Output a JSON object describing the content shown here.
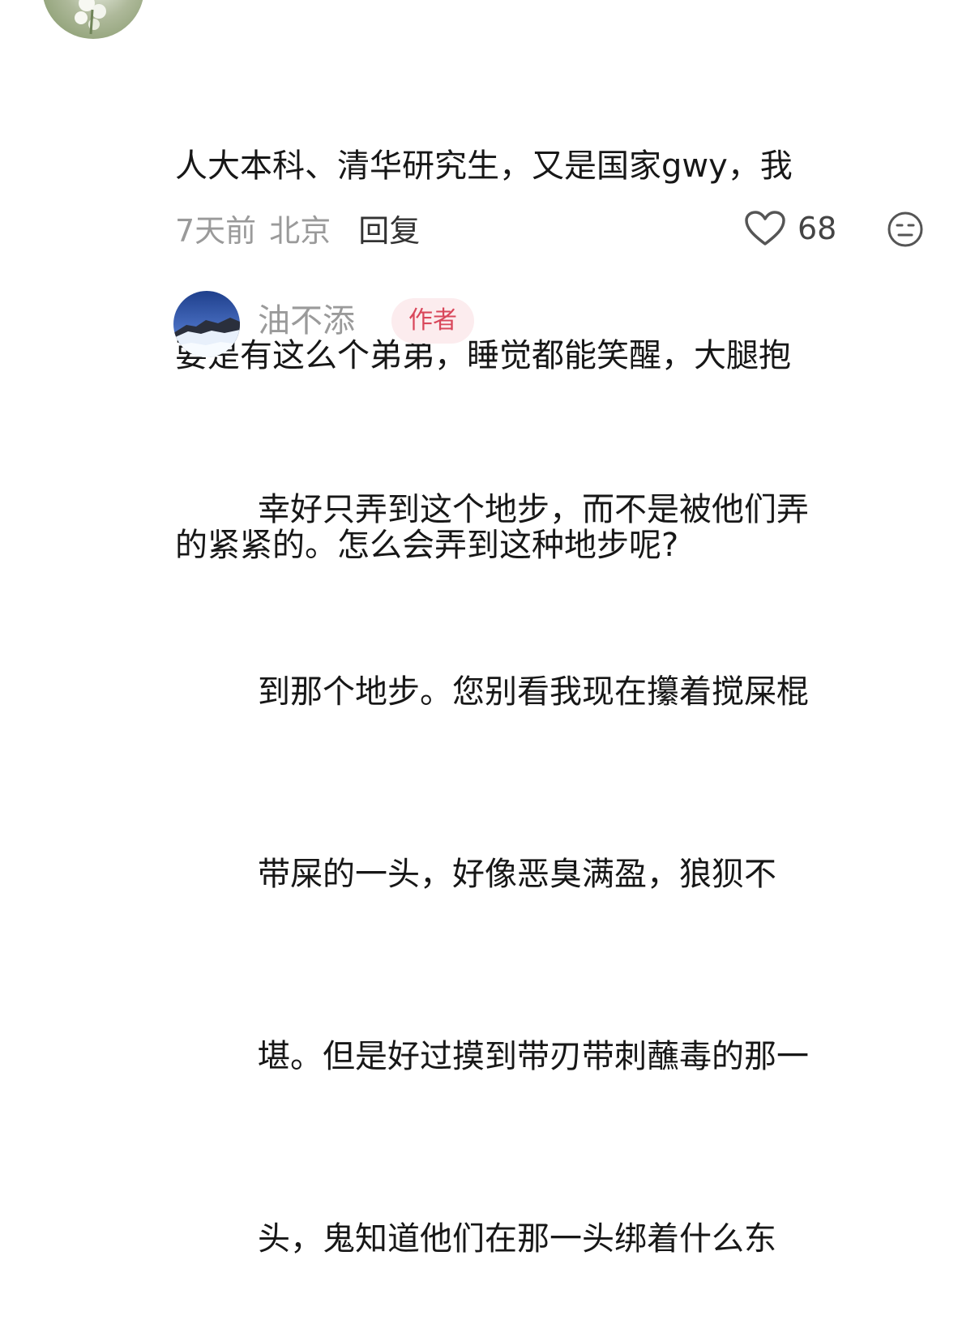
{
  "comment": {
    "lines": [
      "人大本科、清华研究生，又是国家gwy，我",
      "要是有这么个弟弟，睡觉都能笑醒，大腿抱",
      "的紧紧的。怎么会弄到这种地步呢?"
    ],
    "time": "7天前",
    "location": "北京",
    "reply_label": "回复",
    "like_count": "68",
    "icons": {
      "like": "heart-icon",
      "dislike": "dislike-face-icon"
    }
  },
  "reply": {
    "author_name": "油不添",
    "author_badge": "作者",
    "lines": [
      "幸好只弄到这个地步，而不是被他们弄",
      "到那个地步。您别看我现在攥着搅屎棍",
      "带屎的一头，好像恶臭满盈，狼狈不",
      "堪。但是好过摸到带刃带刺蘸毒的那一",
      "头，鬼知道他们在那一头绑着什么东"
    ]
  },
  "colors": {
    "text": "#171717",
    "meta": "#9a9a9a",
    "badge_bg": "#fcecee",
    "badge_text": "#d9475b"
  }
}
